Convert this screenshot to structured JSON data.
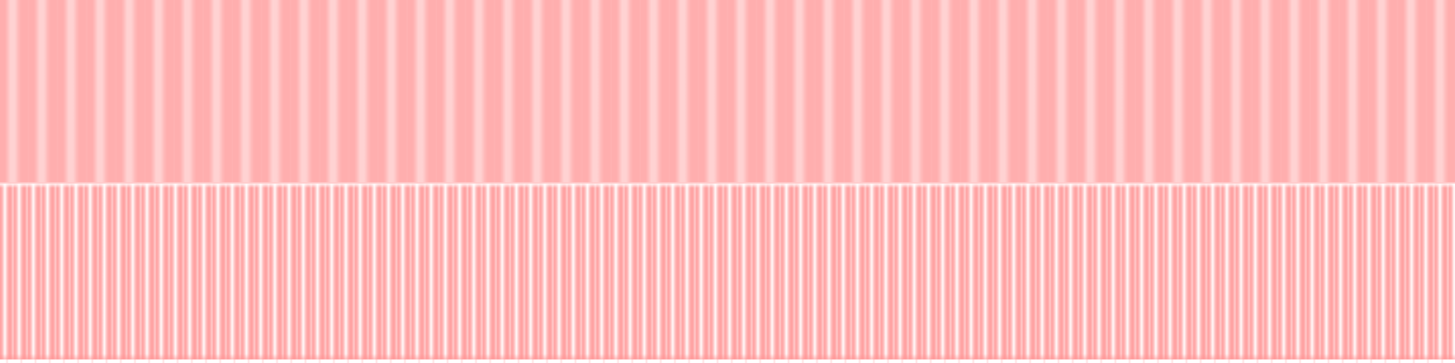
{
  "texture": {
    "kind": "striped-texture",
    "colors": {
      "upper_base": "#ffaeae",
      "upper_light": "#ffd3d3",
      "lower_base": "#ff9e9e",
      "lower_highlight": "#ffffff",
      "divider": "#ffcaca"
    }
  }
}
